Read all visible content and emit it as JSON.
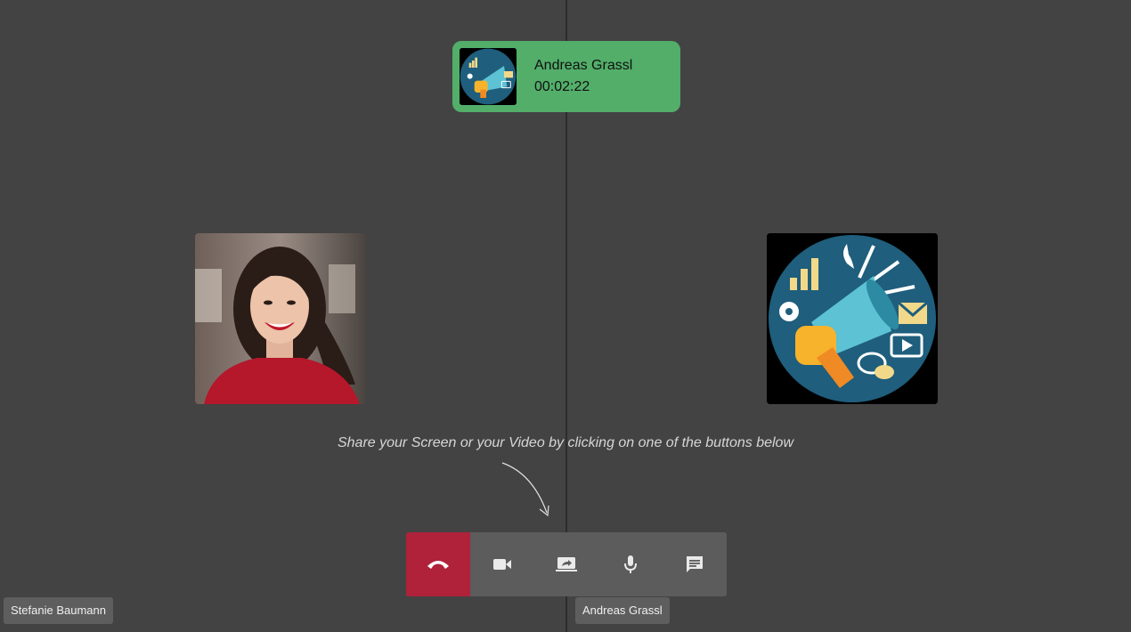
{
  "call": {
    "caller_name": "Andreas Grassl",
    "duration": "00:02:22"
  },
  "hint_text": "Share your Screen or your Video by clicking on one of the buttons below",
  "toolbar": {
    "buttons": [
      {
        "icon": "hangup-phone-icon",
        "color": "#b0213a"
      },
      {
        "icon": "video-camera-icon"
      },
      {
        "icon": "share-screen-icon"
      },
      {
        "icon": "microphone-icon"
      },
      {
        "icon": "chat-icon"
      }
    ]
  },
  "participants": {
    "local_name": "Stefanie Baumann",
    "remote_name": "Andreas Grassl"
  },
  "colors": {
    "background": "#434343",
    "banner": "#52ae69",
    "hangup": "#b0213a",
    "toolbar": "#5c5c5c"
  }
}
